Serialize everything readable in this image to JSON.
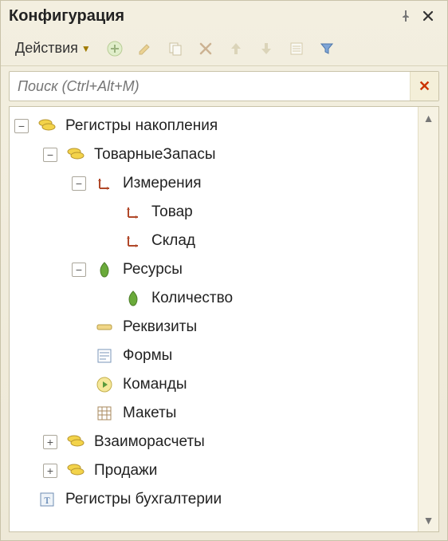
{
  "title": "Конфигурация",
  "toolbar": {
    "actions_label": "Действия"
  },
  "search": {
    "placeholder": "Поиск (Ctrl+Alt+M)"
  },
  "tree": {
    "n0": {
      "label": "Регистры накопления"
    },
    "n1": {
      "label": "ТоварныеЗапасы"
    },
    "n2": {
      "label": "Измерения"
    },
    "n3": {
      "label": "Товар"
    },
    "n4": {
      "label": "Склад"
    },
    "n5": {
      "label": "Ресурсы"
    },
    "n6": {
      "label": "Количество"
    },
    "n7": {
      "label": "Реквизиты"
    },
    "n8": {
      "label": "Формы"
    },
    "n9": {
      "label": "Команды"
    },
    "n10": {
      "label": "Макеты"
    },
    "n11": {
      "label": "Взаиморасчеты"
    },
    "n12": {
      "label": "Продажи"
    },
    "n13": {
      "label": "Регистры бухгалтерии"
    }
  }
}
